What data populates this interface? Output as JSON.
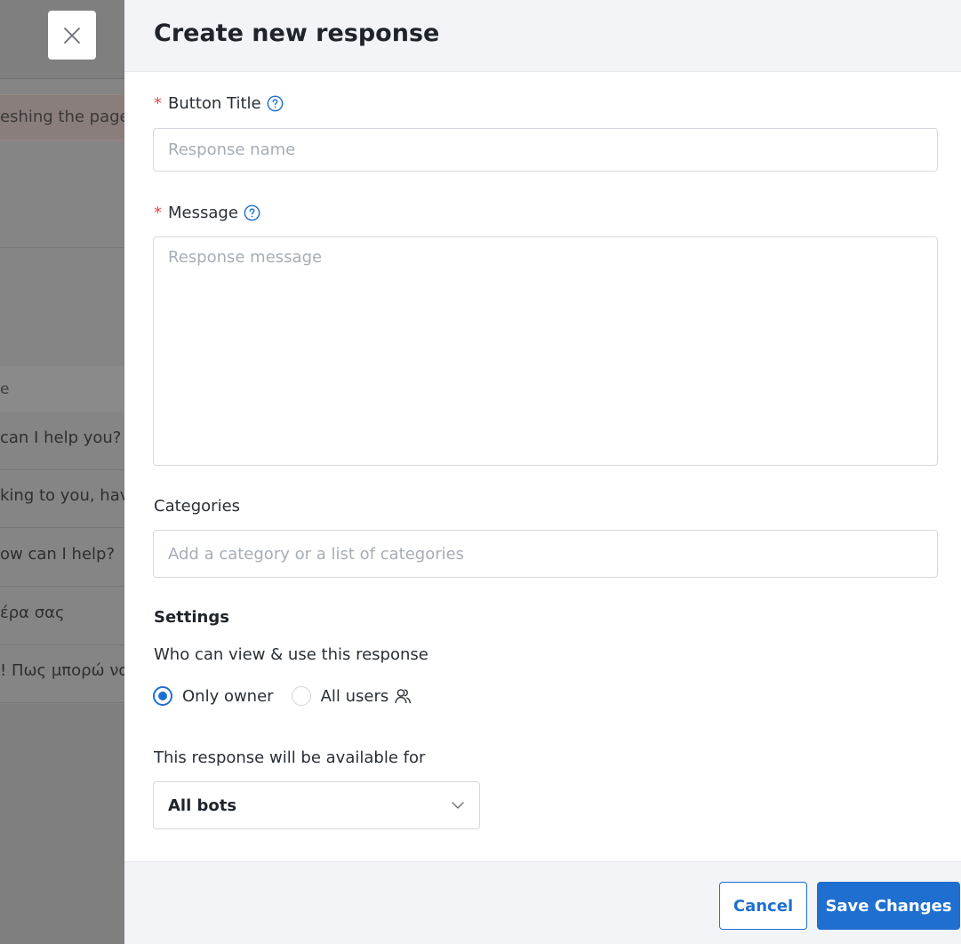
{
  "background": {
    "banner_text": "eshing the page",
    "table_header": "e",
    "rows": [
      "can I help you?",
      "king to you, have",
      "ow can I help?",
      "έρα σας",
      "! Πως μπορώ να"
    ]
  },
  "drawer": {
    "title": "Create new response",
    "button_title": {
      "required_mark": "*",
      "label": "Button Title",
      "placeholder": "Response name",
      "value": ""
    },
    "message": {
      "required_mark": "*",
      "label": "Message",
      "placeholder": "Response message",
      "value": ""
    },
    "categories": {
      "label": "Categories",
      "placeholder": "Add a category or a list of categories",
      "value": ""
    },
    "settings": {
      "title": "Settings",
      "visibility_label": "Who can view & use this response",
      "options": [
        {
          "label": "Only owner",
          "checked": true
        },
        {
          "label": "All users",
          "checked": false
        }
      ],
      "availability_label": "This response will be available for",
      "availability_value": "All bots"
    },
    "footer": {
      "cancel_label": "Cancel",
      "save_label": "Save Changes"
    }
  },
  "colors": {
    "primary": "#1f6fd1",
    "required": "#e04b4b",
    "header_bg": "#f3f4f8"
  },
  "icons": {
    "close": "close-icon",
    "help": "help-circle-icon",
    "users": "users-icon",
    "dropdown": "chevron-down-icon"
  }
}
